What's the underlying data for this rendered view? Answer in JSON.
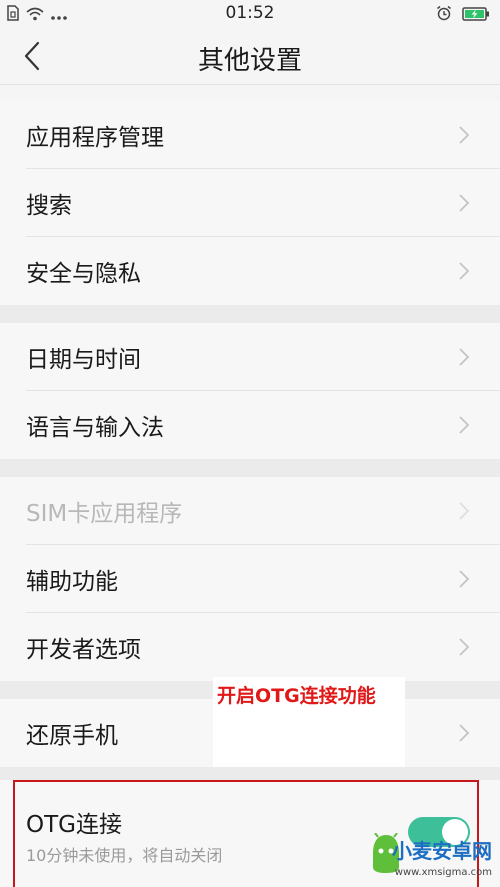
{
  "status_bar": {
    "time": "01:52",
    "left_icons": [
      "sim-icon",
      "wifi-icon",
      "more-dots-icon"
    ],
    "right_icons": [
      "alarm-icon",
      "battery-charging-icon"
    ]
  },
  "header": {
    "title": "其他设置",
    "back_icon": "chevron-left-icon"
  },
  "groups": [
    {
      "items": [
        {
          "label": "应用程序管理",
          "enabled": true
        },
        {
          "label": "搜索",
          "enabled": true
        },
        {
          "label": "安全与隐私",
          "enabled": true
        }
      ]
    },
    {
      "items": [
        {
          "label": "日期与时间",
          "enabled": true
        },
        {
          "label": "语言与输入法",
          "enabled": true
        }
      ]
    },
    {
      "items": [
        {
          "label": "SIM卡应用程序",
          "enabled": false
        },
        {
          "label": "辅助功能",
          "enabled": true
        },
        {
          "label": "开发者选项",
          "enabled": true
        }
      ]
    },
    {
      "items": [
        {
          "label": "还原手机",
          "enabled": true
        }
      ]
    }
  ],
  "annotation": {
    "text": "开启OTG连接功能",
    "color": "#e01818"
  },
  "otg": {
    "title": "OTG连接",
    "subtitle": "10分钟未使用，将自动关闭",
    "toggle_on": true,
    "toggle_color": "#3dbf9a",
    "highlight_color": "#c8161d"
  },
  "watermark": {
    "name": "小麦安卓网",
    "url": "www.xmsigma.com"
  }
}
